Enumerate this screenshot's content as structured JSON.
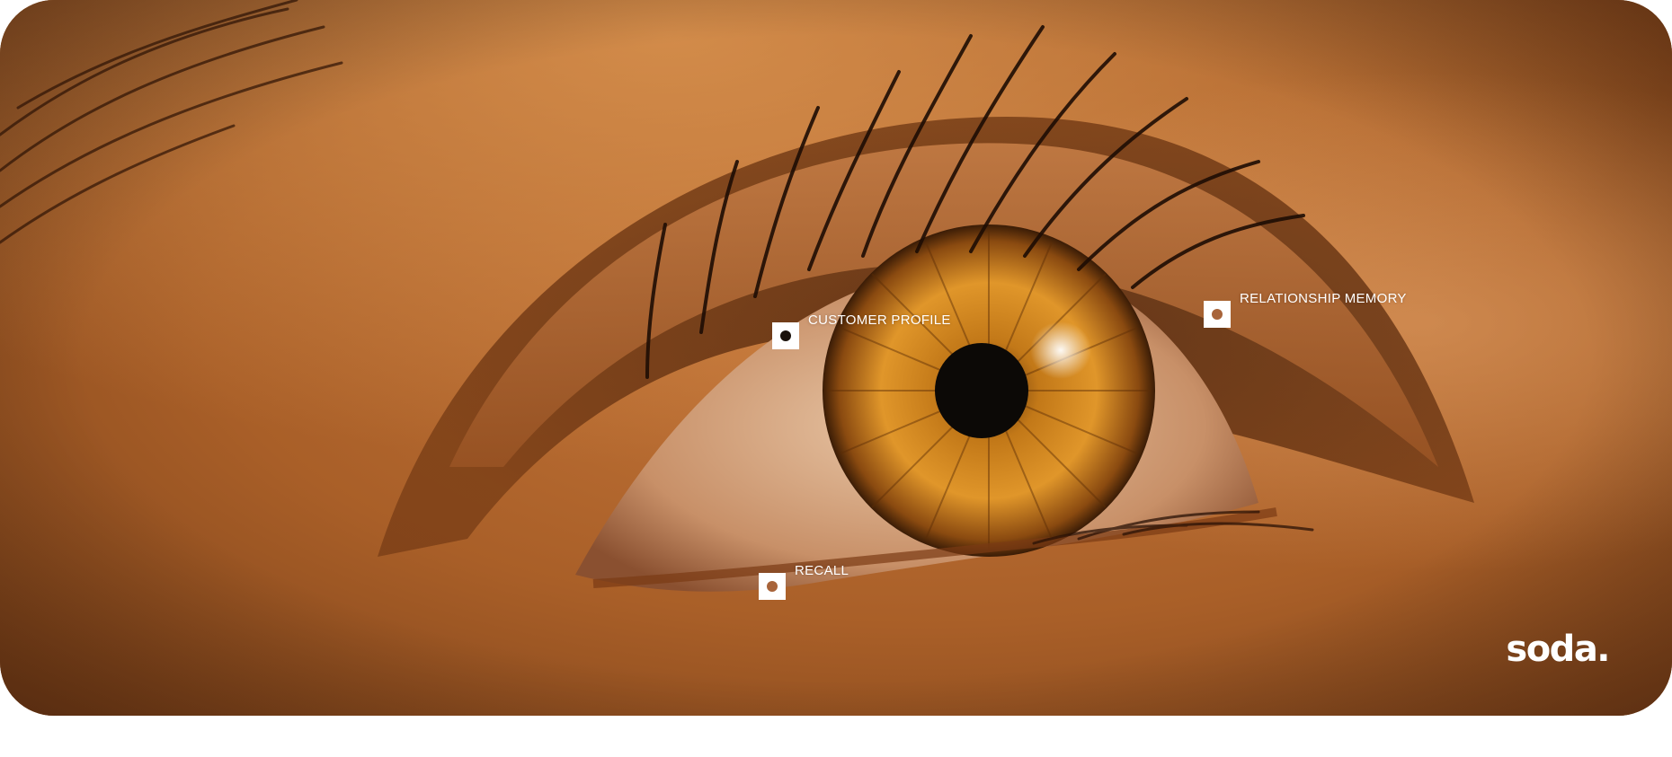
{
  "hotspots": [
    {
      "label": "CUSTOMER PROFILE",
      "style": "dark"
    },
    {
      "label": "RELATIONSHIP MEMORY",
      "style": "warm"
    },
    {
      "label": "RECALL",
      "style": "warm"
    }
  ],
  "logo": {
    "text": "soda."
  },
  "colors": {
    "skin": "#b8692e",
    "iris": "#c07a22",
    "pupil": "#0c0906",
    "marker": "#ffffff"
  }
}
